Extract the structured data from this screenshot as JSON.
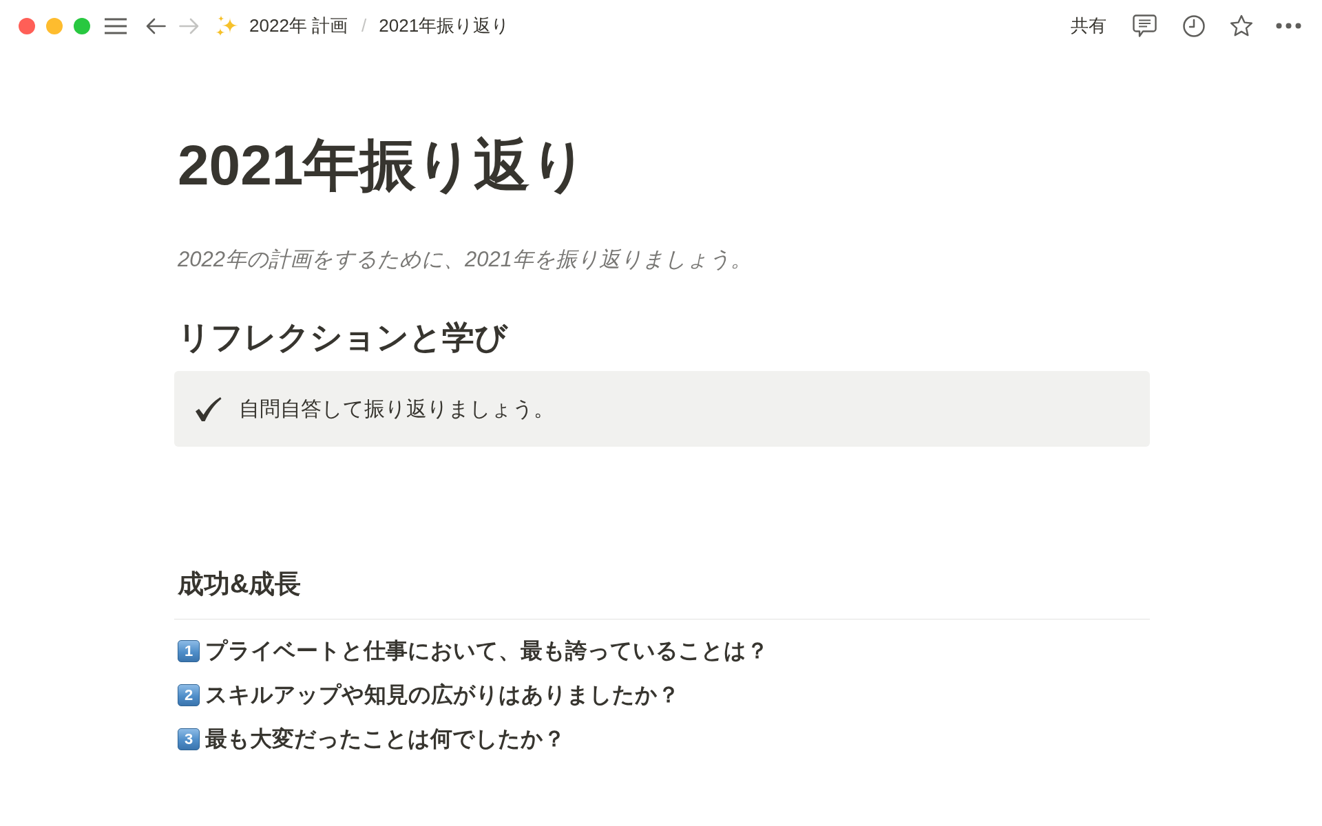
{
  "window": {
    "traffic_lights": [
      {
        "color": "#ff5f57"
      },
      {
        "color": "#febc2e"
      },
      {
        "color": "#28c840"
      }
    ]
  },
  "topbar": {
    "nav": [
      {
        "kind": "back",
        "disabled": false
      },
      {
        "kind": "forward",
        "disabled": true
      }
    ],
    "breadcrumbs": [
      {
        "kind": "emoji_page",
        "label": "2022年 計画"
      },
      {
        "kind": "page",
        "label": "2021年振り返り"
      }
    ],
    "separator": "/",
    "share": "共有"
  },
  "page": {
    "title": "2021年振り返り",
    "description": "2022年の計画をするために、2021年を振り返りましょう。",
    "blocks": [
      {
        "kind": "heading_1",
        "text": "リフレクションと学び"
      },
      {
        "kind": "callout",
        "text": "自問自答して振り返りましょう。"
      },
      {
        "kind": "heading_2",
        "text": "成功&成長"
      },
      {
        "kind": "divider"
      },
      {
        "kind": "numbered",
        "number": "1",
        "text": "プライベートと仕事において、最も誇っていることは？"
      },
      {
        "kind": "numbered",
        "number": "2",
        "text": "スキルアップや知見の広がりはありましたか？"
      },
      {
        "kind": "numbered",
        "number": "3",
        "text": "最も大変だったことは何でしたか？"
      }
    ]
  }
}
